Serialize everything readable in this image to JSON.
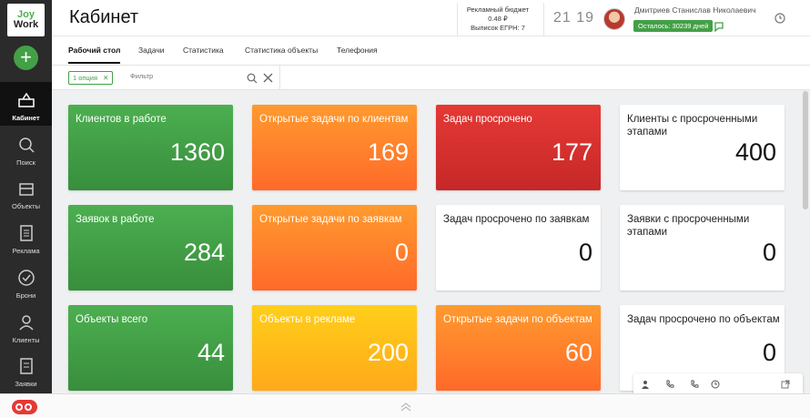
{
  "brand": {
    "line1": "Joy",
    "line2": "Work"
  },
  "sidebar": {
    "add_label": "+",
    "items": [
      {
        "label": "Кабинет",
        "icon": "cabinet-icon",
        "active": true
      },
      {
        "label": "Поиск",
        "icon": "search-icon"
      },
      {
        "label": "Объекты",
        "icon": "objects-icon"
      },
      {
        "label": "Реклама",
        "icon": "ads-icon"
      },
      {
        "label": "Брони",
        "icon": "bookings-icon"
      },
      {
        "label": "Клиенты",
        "icon": "clients-icon"
      },
      {
        "label": "Заявки",
        "icon": "requests-icon"
      }
    ]
  },
  "header": {
    "title": "Кабинет",
    "budget_label": "Рекламный бюджет",
    "budget_value": "0.48 ₽",
    "egrn": "Выписок ЕГРН: 7",
    "time": "21 19",
    "user_name": "Дмитриев Станислав Николаевич",
    "remaining": "Осталось: 30239 дней"
  },
  "tabs": [
    "Рабочий стол",
    "Задачи",
    "Статистика",
    "Статистика объекты",
    "Телефония"
  ],
  "filter": {
    "chip": "1 опция",
    "chip_close": "✕",
    "placeholder": "Фильтр"
  },
  "cards": [
    {
      "title": "Клиентов в работе",
      "value": "1360",
      "color": "green"
    },
    {
      "title": "Открытые задачи по клиентам",
      "value": "169",
      "color": "orange"
    },
    {
      "title": "Задач просрочено",
      "value": "177",
      "color": "red"
    },
    {
      "title": "Клиенты с просроченными этапами",
      "value": "400",
      "color": "white"
    },
    {
      "title": "Заявок в работе",
      "value": "284",
      "color": "green"
    },
    {
      "title": "Открытые задачи по заявкам",
      "value": "0",
      "color": "orange"
    },
    {
      "title": "Задач просрочено по заявкам",
      "value": "0",
      "color": "white"
    },
    {
      "title": "Заявки с просроченными этапами",
      "value": "0",
      "color": "white"
    },
    {
      "title": "Объекты всего",
      "value": "44",
      "color": "green"
    },
    {
      "title": "Объекты в рекламе",
      "value": "200",
      "color": "yellow"
    },
    {
      "title": "Открытые задачи по объектам",
      "value": "60",
      "color": "orange"
    },
    {
      "title": "Задач просрочено по объектам",
      "value": "0",
      "color": "white"
    }
  ],
  "colors": {
    "accent": "#43a047",
    "orange": "#ff7a2a",
    "red": "#d32f2f",
    "yellow": "#ffc21a",
    "sidebar": "#2b2b2b"
  }
}
